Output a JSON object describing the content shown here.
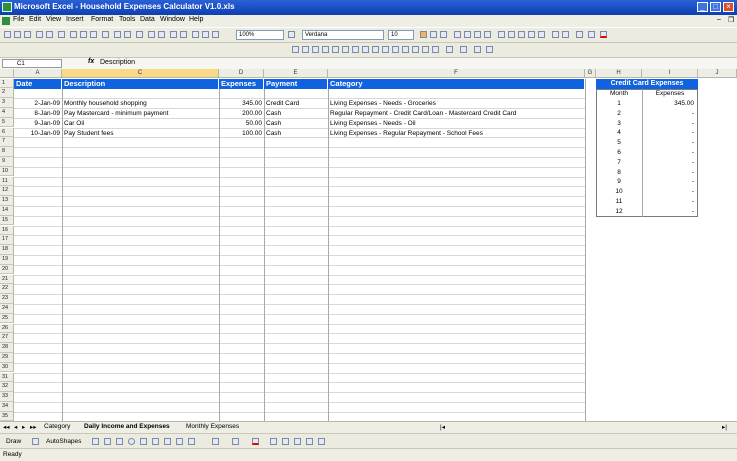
{
  "window": {
    "title": "Microsoft Excel - Household Expenses Calculator V1.0.xls"
  },
  "menu": [
    "File",
    "Edit",
    "View",
    "Insert",
    "Format",
    "Tools",
    "Data",
    "Window",
    "Help"
  ],
  "toolbar": {
    "zoom": "100%",
    "font": "Verdana",
    "font_size": "10"
  },
  "formula_bar": {
    "name_box": "C1",
    "fx": "fx",
    "value": "Description"
  },
  "columns": [
    "A",
    "C",
    "D",
    "E",
    "F",
    "G",
    "H",
    "I",
    "J"
  ],
  "headers": {
    "date": "Date",
    "description": "Description",
    "expenses": "Expenses",
    "payment": "Payment",
    "category": "Category"
  },
  "rows": [
    {
      "date": "2-Jan-09",
      "description": "Monthly household shopping",
      "expenses": "345.00",
      "payment": "Credit Card",
      "category": "Living Expenses - Needs - Groceries"
    },
    {
      "date": "8-Jan-09",
      "description": "Pay Mastercard - minimum payment",
      "expenses": "200.00",
      "payment": "Cash",
      "category": "Regular Repayment - Credit Card/Loan - Mastercard Credit Card"
    },
    {
      "date": "9-Jan-09",
      "description": "Car Oil",
      "expenses": "50.00",
      "payment": "Cash",
      "category": "Living Expenses - Needs - Oil"
    },
    {
      "date": "10-Jan-09",
      "description": "Pay Student fees",
      "expenses": "100.00",
      "payment": "Cash",
      "category": "Living Expenses - Regular Repayment - School Fees"
    }
  ],
  "row_numbers": [
    "1",
    "2",
    "3",
    "4",
    "5",
    "6",
    "7",
    "8",
    "9",
    "10",
    "11",
    "12",
    "13",
    "14",
    "15",
    "16",
    "17",
    "18",
    "19",
    "20",
    "21",
    "22",
    "23",
    "24",
    "25",
    "26",
    "27",
    "28",
    "29",
    "30",
    "31",
    "32",
    "33",
    "34",
    "35"
  ],
  "credit_card": {
    "title": "Credit Card Expenses",
    "month_label": "Month",
    "expenses_label": "Expenses",
    "months": [
      "1",
      "2",
      "3",
      "4",
      "5",
      "6",
      "7",
      "8",
      "9",
      "10",
      "11",
      "12"
    ],
    "values": [
      "345.00",
      "-",
      "-",
      "-",
      "-",
      "-",
      "-",
      "-",
      "-",
      "-",
      "-",
      "-"
    ]
  },
  "sheet_tabs": [
    "Category",
    "Daily Income and Expenses",
    "Monthly Expenses"
  ],
  "drawing": {
    "draw": "Draw",
    "autoshapes": "AutoShapes"
  },
  "status": "Ready"
}
